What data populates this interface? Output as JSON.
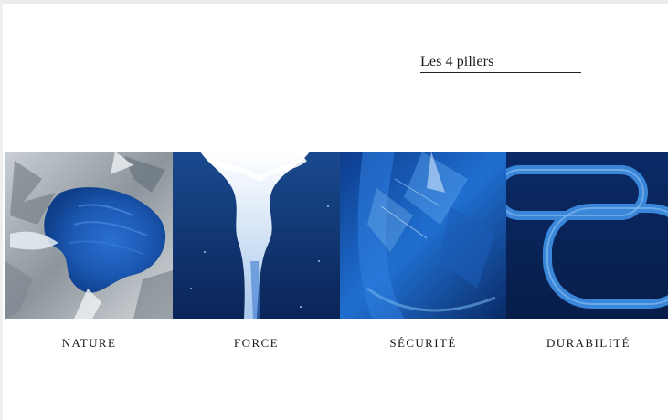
{
  "section": {
    "heading": "Les 4 piliers"
  },
  "pillars": [
    {
      "label": "NATURE",
      "image": "aerial-glacier-lake"
    },
    {
      "label": "FORCE",
      "image": "water-splash-column"
    },
    {
      "label": "SÉCURITÉ",
      "image": "blue-glass-shard"
    },
    {
      "label": "DURABILITÉ",
      "image": "blue-chain-links"
    }
  ],
  "colors": {
    "deep_blue": "#0a2a66",
    "mid_blue": "#1d5fb8",
    "light_blue": "#6fb1ea",
    "rock_grey": "#9aa4ad"
  }
}
